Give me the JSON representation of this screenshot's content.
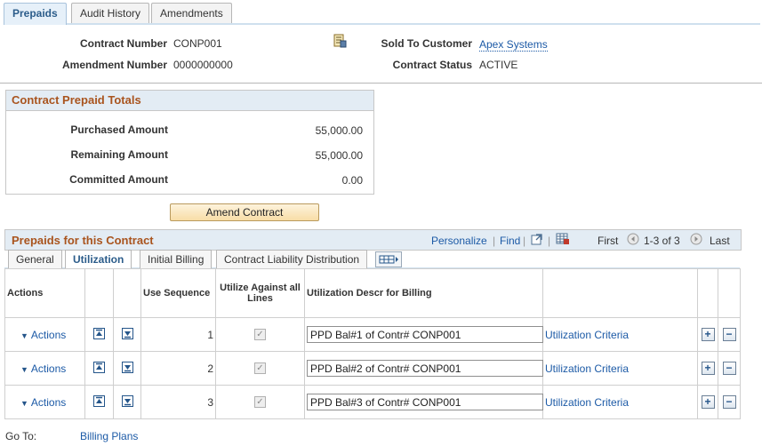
{
  "tabs": [
    "Prepaids",
    "Audit History",
    "Amendments"
  ],
  "header": {
    "contract_number_label": "Contract Number",
    "contract_number": "CONP001",
    "amendment_number_label": "Amendment Number",
    "amendment_number": "0000000000",
    "sold_to_label": "Sold To Customer",
    "sold_to": "Apex Systems",
    "status_label": "Contract Status",
    "status": "ACTIVE"
  },
  "totals": {
    "title": "Contract Prepaid Totals",
    "purchased_label": "Purchased Amount",
    "purchased": "55,000.00",
    "remaining_label": "Remaining Amount",
    "remaining": "55,000.00",
    "committed_label": "Committed Amount",
    "committed": "0.00"
  },
  "amend_button": "Amend Contract",
  "grid": {
    "title": "Prepaids for this Contract",
    "personalize": "Personalize",
    "find": "Find",
    "first": "First",
    "range": "1-3 of 3",
    "last": "Last",
    "subtabs": [
      "General",
      "Utilization",
      "Initial Billing",
      "Contract Liability Distribution"
    ],
    "columns": {
      "actions": "Actions",
      "use_sequence": "Use Sequence",
      "utilize_all": "Utilize Against all Lines",
      "descr": "Utilization Descr for Billing"
    },
    "rows": [
      {
        "actions": "Actions",
        "seq": "1",
        "descr": "PPD Bal#1 of Contr# CONP001",
        "criteria": "Utilization Criteria"
      },
      {
        "actions": "Actions",
        "seq": "2",
        "descr": "PPD Bal#2 of Contr# CONP001",
        "criteria": "Utilization Criteria"
      },
      {
        "actions": "Actions",
        "seq": "3",
        "descr": "PPD Bal#3 of Contr# CONP001",
        "criteria": "Utilization Criteria"
      }
    ]
  },
  "goto": {
    "label": "Go To:",
    "link": "Billing Plans"
  }
}
